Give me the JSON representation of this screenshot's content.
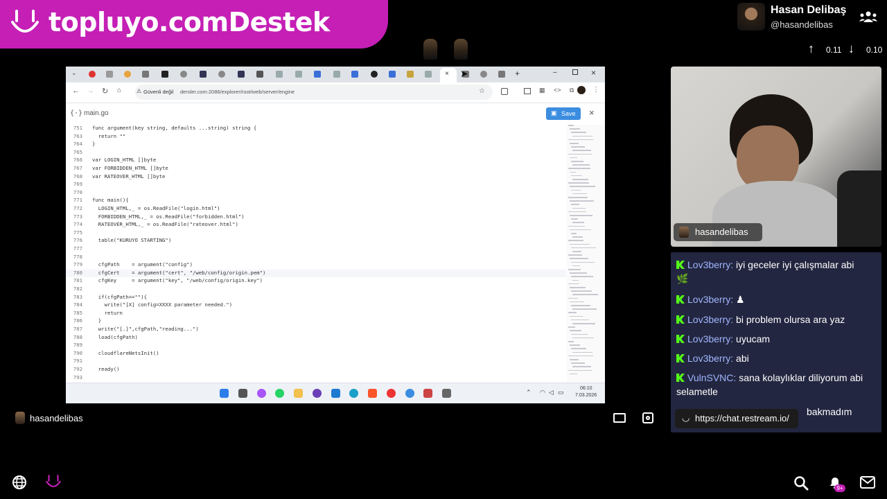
{
  "banner": {
    "text": "topluyo.comDestek"
  },
  "streamer": {
    "name": "Hasan Delibaş",
    "handle": "@hasandelibas",
    "cam_label": "hasandelibas",
    "bottom_name": "hasandelibas"
  },
  "stats": {
    "up": "0.11",
    "down": "0.10"
  },
  "browser": {
    "security": "Güvenli değil",
    "url": "dersler.com:2086/explorer/root/web/server/engine"
  },
  "editor": {
    "filename": "main.go",
    "save_label": "Save",
    "lines": [
      {
        "n": "751",
        "t": "func argument(key string, defaults ...string) string {"
      },
      {
        "n": "763",
        "t": "  return \"\""
      },
      {
        "n": "764",
        "t": "}"
      },
      {
        "n": "765",
        "t": ""
      },
      {
        "n": "766",
        "t": "var LOGIN_HTML []byte"
      },
      {
        "n": "767",
        "t": "var FORBIDDEN_HTML []byte"
      },
      {
        "n": "768",
        "t": "var RATEOVER_HTML []byte"
      },
      {
        "n": "769",
        "t": ""
      },
      {
        "n": "770",
        "t": ""
      },
      {
        "n": "771",
        "t": "func main(){"
      },
      {
        "n": "772",
        "t": "  LOGIN_HTML,_ = os.ReadFile(\"login.html\")"
      },
      {
        "n": "773",
        "t": "  FORBIDDEN_HTML,_ = os.ReadFile(\"forbidden.html\")"
      },
      {
        "n": "774",
        "t": "  RATEOVER_HTML,_ = os.ReadFile(\"rateover.html\")"
      },
      {
        "n": "775",
        "t": ""
      },
      {
        "n": "776",
        "t": "  table(\"KURUYO STARTING\")"
      },
      {
        "n": "777",
        "t": ""
      },
      {
        "n": "778",
        "t": ""
      },
      {
        "n": "779",
        "t": "  cfgPath    = argument(\"config\")"
      },
      {
        "n": "780",
        "t": "  cfgCert    = argument(\"cert\", \"/web/config/origin.pem\")"
      },
      {
        "n": "781",
        "t": "  cfgKey     = argument(\"key\", \"/web/config/origin.key\")"
      },
      {
        "n": "782",
        "t": ""
      },
      {
        "n": "783",
        "t": "  if(cfgPath==\"\"){"
      },
      {
        "n": "784",
        "t": "    write(\"[X] config=XXXX parameter needed.\")"
      },
      {
        "n": "785",
        "t": "    return"
      },
      {
        "n": "786",
        "t": "  }"
      },
      {
        "n": "787",
        "t": "  write(\"[.]\",cfgPath,\"reading...\")"
      },
      {
        "n": "788",
        "t": "  load(cfgPath)"
      },
      {
        "n": "789",
        "t": ""
      },
      {
        "n": "790",
        "t": "  cloudflareNetsInit()"
      },
      {
        "n": "791",
        "t": ""
      },
      {
        "n": "792",
        "t": "  ready()"
      },
      {
        "n": "793",
        "t": ""
      }
    ]
  },
  "taskbar": {
    "time": "06:10",
    "date": "7.03.2026"
  },
  "chat": {
    "messages": [
      {
        "user": "Lov3berry:",
        "text": "iyi geceler iyi çalışmalar abi"
      },
      {
        "user": "Lov3berry:",
        "text": "♟"
      },
      {
        "user": "Lov3berry:",
        "text": "bi problem olursa ara yaz"
      },
      {
        "user": "Lov3berry:",
        "text": "uyucam"
      },
      {
        "user": "Lov3berry:",
        "text": "abi"
      },
      {
        "user": "VulnSVNC:",
        "text": "sana kolaylıklar diliyorum abi selametle"
      }
    ],
    "partial": "bakmadım",
    "tooltip": "https://chat.restream.io/"
  },
  "notifications": {
    "badge": "9+"
  },
  "colors": {
    "banner": "#c51fb6",
    "kick": "#53fc18",
    "chat_bg": "#232640",
    "username": "#9fb6ff"
  }
}
